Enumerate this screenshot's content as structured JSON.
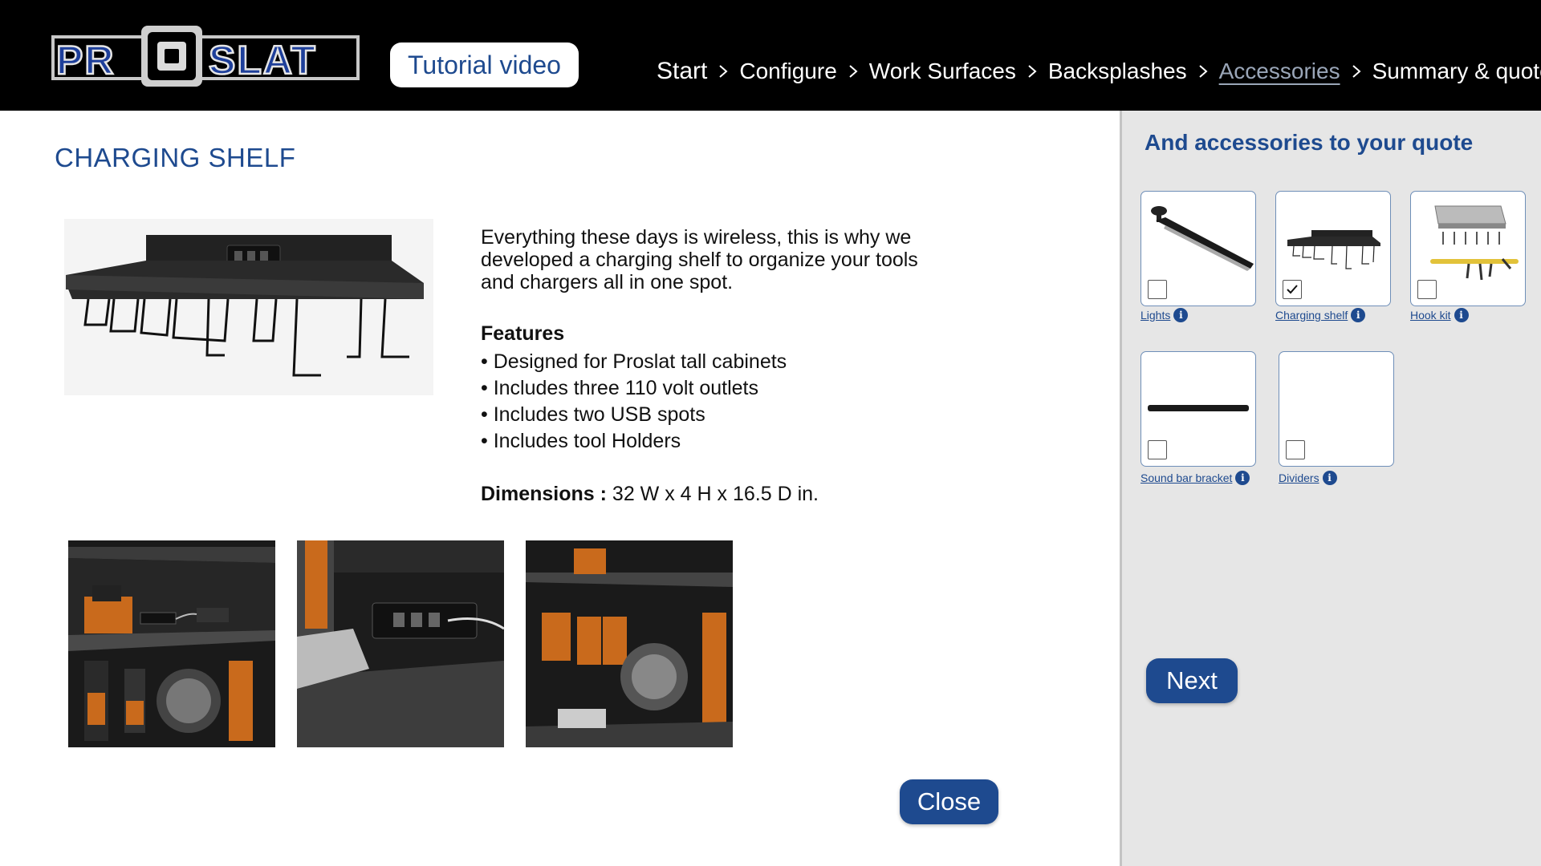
{
  "header": {
    "logo_text": "PROSLAT",
    "tutorial_label": "Tutorial video",
    "breadcrumb": [
      {
        "label": "Start"
      },
      {
        "label": "Configure"
      },
      {
        "label": "Work Surfaces"
      },
      {
        "label": "Backsplashes"
      },
      {
        "label": "Accessories"
      },
      {
        "label": "Summary & quote"
      }
    ],
    "active_step": "Accessories"
  },
  "product": {
    "title": "CHARGING SHELF",
    "description": "Everything these days is wireless, this is why we developed a charging shelf to organize your tools and chargers all in one spot.",
    "features_title": "Features",
    "features": [
      "• Designed for Proslat tall cabinets",
      "• Includes three 110 volt outlets",
      "• Includes two USB spots",
      "• Includes tool Holders"
    ],
    "dimensions_label": "Dimensions :",
    "dimensions_value": " 32 W  x  4 H x 16.5 D in.",
    "close_label": "Close"
  },
  "sidebar": {
    "title": "And accessories to your quote",
    "accessories": [
      {
        "label": "Lights",
        "checked": false,
        "icon": "light-bar-icon"
      },
      {
        "label": "Charging shelf",
        "checked": true,
        "icon": "charging-shelf-icon"
      },
      {
        "label": "Hook kit",
        "checked": false,
        "icon": "hook-kit-icon"
      },
      {
        "label": "Sound bar bracket ",
        "checked": false,
        "icon": "sound-bar-icon"
      },
      {
        "label": "Dividers",
        "checked": false,
        "icon": "dividers-icon"
      }
    ],
    "next_label": "Next"
  },
  "colors": {
    "brand_blue": "#1e4a8f",
    "header_bg": "#000000",
    "sidebar_bg": "#e6e6e6",
    "inactive_crumb": "#9aa6b8"
  }
}
